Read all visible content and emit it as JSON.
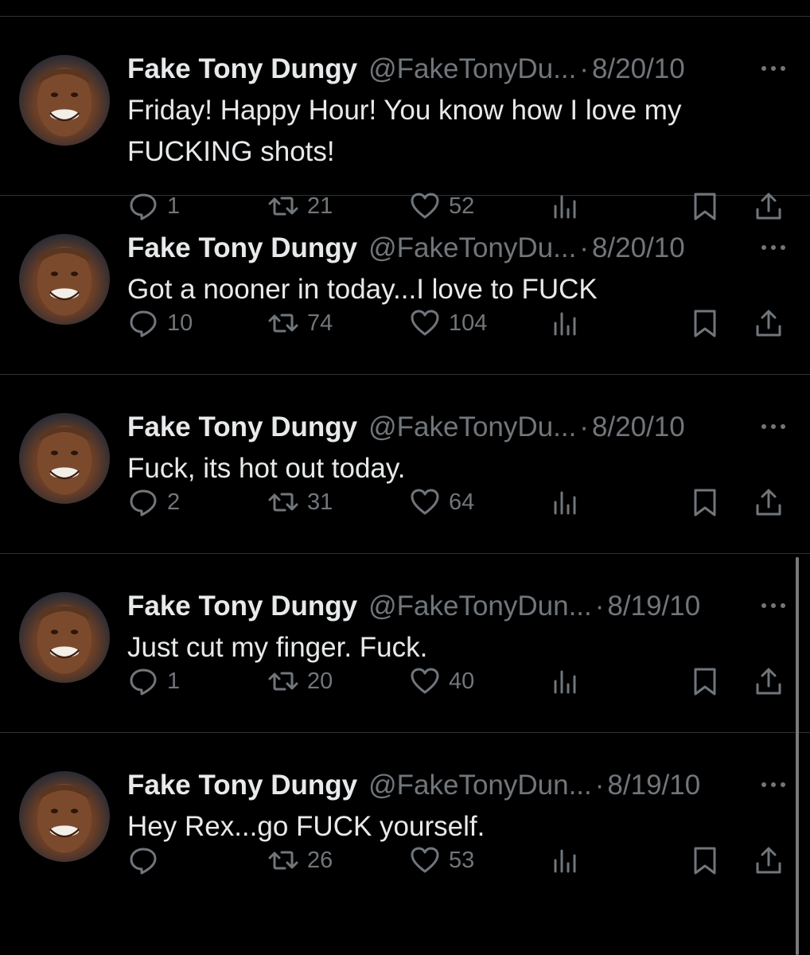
{
  "colors": {
    "background": "#000000",
    "text": "#e7e9ea",
    "muted": "#71767b",
    "divider": "#2f3336"
  },
  "icons": {
    "reply": "speech-bubble-icon",
    "repost": "repost-arrows-icon",
    "like": "heart-icon",
    "views": "bar-chart-icon",
    "bookmark": "bookmark-icon",
    "share": "share-upload-icon",
    "more": "more-dots-icon"
  },
  "tweets": [
    {
      "name": "Fake Tony Dungy",
      "handle": "@FakeTonyDu...",
      "separator": "·",
      "date": "8/20/10",
      "text": "Friday! Happy Hour! You know how I love my FUCKING shots!",
      "replies": "1",
      "reposts": "21",
      "likes": "52"
    },
    {
      "name": "Fake Tony Dungy",
      "handle": "@FakeTonyDu...",
      "separator": "·",
      "date": "8/20/10",
      "text": "Got a nooner in today...I love to FUCK",
      "replies": "10",
      "reposts": "74",
      "likes": "104"
    },
    {
      "name": "Fake Tony Dungy",
      "handle": "@FakeTonyDu...",
      "separator": "·",
      "date": "8/20/10",
      "text": "Fuck, its hot out today.",
      "replies": "2",
      "reposts": "31",
      "likes": "64"
    },
    {
      "name": "Fake Tony Dungy",
      "handle": "@FakeTonyDun...",
      "separator": "·",
      "date": "8/19/10",
      "text": "Just cut my finger. Fuck.",
      "replies": "1",
      "reposts": "20",
      "likes": "40"
    },
    {
      "name": "Fake Tony Dungy",
      "handle": "@FakeTonyDun...",
      "separator": "·",
      "date": "8/19/10",
      "text": "Hey Rex...go FUCK yourself.",
      "replies": "",
      "reposts": "26",
      "likes": "53"
    }
  ]
}
